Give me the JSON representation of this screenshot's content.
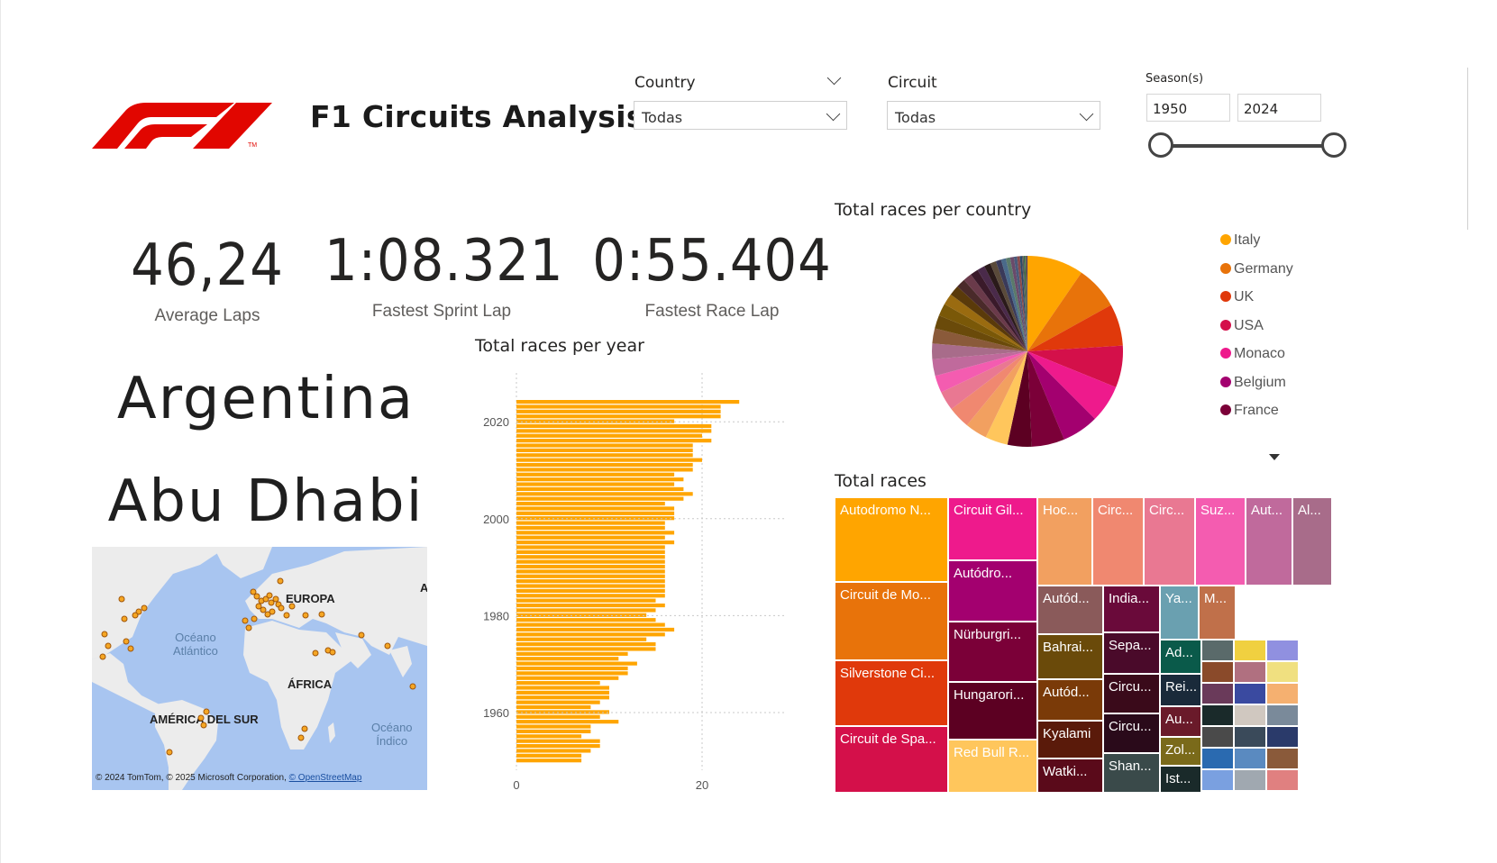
{
  "header": {
    "title": "F1 Circuits Analysis"
  },
  "filters": {
    "country": {
      "label": "Country",
      "value": "Todas"
    },
    "circuit": {
      "label": "Circuit",
      "value": "Todas"
    },
    "season": {
      "label": "Season(s)",
      "from": "1950",
      "to": "2024"
    }
  },
  "kpis": {
    "average_laps": {
      "value": "46,24",
      "label": "Average Laps"
    },
    "fastest_sprint": {
      "value": "1:08.321",
      "label": "Fastest Sprint Lap"
    },
    "fastest_race": {
      "value": "0:55.404",
      "label": "Fastest Race Lap"
    }
  },
  "cards": {
    "country_name": "Argentina",
    "circuit_name": "Abu Dhabi"
  },
  "map": {
    "labels": [
      "EUROPA",
      "ÁFRICA",
      "AMÉRICA DEL SUR",
      "A"
    ],
    "oceans": [
      "Océano\nAtlántico",
      "Océano\nÍndico"
    ],
    "attribution": "© 2024 TomTom, © 2025 Microsoft Corporation,",
    "attribution_link": "© OpenStreetMap"
  },
  "chart_data": [
    {
      "type": "bar",
      "title": "Total races per year",
      "orientation": "horizontal",
      "color": "#FFA500",
      "ytick_labels": [
        "2020",
        "2000",
        "1980",
        "1960"
      ],
      "xtick_labels": [
        "0",
        "20"
      ],
      "xlim": [
        0,
        30
      ],
      "grid": true,
      "years": [
        2024,
        2023,
        2022,
        2021,
        2020,
        2019,
        2018,
        2017,
        2016,
        2015,
        2014,
        2013,
        2012,
        2011,
        2010,
        2009,
        2008,
        2007,
        2006,
        2005,
        2004,
        2003,
        2002,
        2001,
        2000,
        1999,
        1998,
        1997,
        1996,
        1995,
        1994,
        1993,
        1992,
        1991,
        1990,
        1989,
        1988,
        1987,
        1986,
        1985,
        1984,
        1983,
        1982,
        1981,
        1980,
        1979,
        1978,
        1977,
        1976,
        1975,
        1974,
        1973,
        1972,
        1971,
        1970,
        1969,
        1968,
        1967,
        1966,
        1965,
        1964,
        1963,
        1962,
        1961,
        1960,
        1959,
        1958,
        1957,
        1956,
        1955,
        1954,
        1953,
        1952,
        1951,
        1950
      ],
      "values": [
        24,
        22,
        22,
        22,
        17,
        21,
        21,
        20,
        21,
        19,
        19,
        19,
        20,
        19,
        19,
        17,
        18,
        17,
        18,
        19,
        18,
        16,
        17,
        17,
        17,
        16,
        16,
        17,
        16,
        17,
        16,
        16,
        16,
        16,
        16,
        16,
        16,
        16,
        16,
        16,
        16,
        15,
        16,
        15,
        14,
        15,
        16,
        17,
        16,
        14,
        15,
        15,
        12,
        11,
        13,
        12,
        12,
        11,
        9,
        10,
        10,
        10,
        9,
        8,
        10,
        9,
        11,
        8,
        8,
        7,
        9,
        9,
        8,
        7,
        7
      ]
    },
    {
      "type": "pie",
      "title": "Total races per country",
      "legend_position": "right",
      "legend": [
        {
          "name": "Italy",
          "color": "#FFA500"
        },
        {
          "name": "Germany",
          "color": "#E8730A"
        },
        {
          "name": "UK",
          "color": "#E0390B"
        },
        {
          "name": "USA",
          "color": "#D4104A"
        },
        {
          "name": "Monaco",
          "color": "#EE1A8C"
        },
        {
          "name": "Belgium",
          "color": "#A3006F"
        },
        {
          "name": "France",
          "color": "#7B0038"
        }
      ],
      "values": [
        105,
        81,
        78,
        78,
        70,
        68,
        61,
        45,
        42,
        41,
        41,
        36,
        32,
        31,
        29,
        28,
        25,
        23,
        21,
        19,
        17,
        16,
        15,
        14,
        12,
        11,
        10,
        9,
        8,
        7,
        6,
        5,
        4,
        3,
        3,
        2,
        2
      ],
      "colors": [
        "#FFA500",
        "#E8730A",
        "#E0390B",
        "#D4104A",
        "#EE1A8C",
        "#A3006F",
        "#7B0038",
        "#5C0022",
        "#FFC65C",
        "#F2A060",
        "#F08870",
        "#E97892",
        "#F45CB0",
        "#C06A9C",
        "#A86C8A",
        "#8A5A3A",
        "#6A4A0A",
        "#7A5808",
        "#9A6B10",
        "#5A3A0A",
        "#4A2A2A",
        "#6A3A4A",
        "#3A1A2A",
        "#4A2A4A",
        "#2A1A1A",
        "#5A4A3A",
        "#3A3A5A",
        "#4A6A8A",
        "#5A7A6A",
        "#6A4A6A",
        "#4A5A7A",
        "#8A4A4A",
        "#2A4A6A",
        "#5A5A5A",
        "#3A6A4A",
        "#6A6A3A",
        "#4A3A6A"
      ]
    },
    {
      "type": "treemap",
      "title": "Total races",
      "cells": [
        {
          "label": "Autodromo N...",
          "color": "#FFA500"
        },
        {
          "label": "Circuit de Mo...",
          "color": "#E8730A"
        },
        {
          "label": "Silverstone Ci...",
          "color": "#E0390B"
        },
        {
          "label": "Circuit de Spa...",
          "color": "#D4104A"
        },
        {
          "label": "Circuit Gil...",
          "color": "#EE1A8C"
        },
        {
          "label": "Autódro...",
          "color": "#A3006F"
        },
        {
          "label": "Nürburgri...",
          "color": "#7B0038"
        },
        {
          "label": "Hungarori...",
          "color": "#5C0022"
        },
        {
          "label": "Red Bull R...",
          "color": "#FFC65C"
        },
        {
          "label": "Hoc...",
          "color": "#F2A060"
        },
        {
          "label": "Circ...",
          "color": "#F08870"
        },
        {
          "label": "Circ...",
          "color": "#E97892"
        },
        {
          "label": "Suz...",
          "color": "#F45CB0"
        },
        {
          "label": "Aut...",
          "color": "#C06A9C"
        },
        {
          "label": "Al...",
          "color": "#A86C8A"
        },
        {
          "label": "Autód...",
          "color": "#8A5A5A"
        },
        {
          "label": "Bahrai...",
          "color": "#6A4A0A"
        },
        {
          "label": "Autód...",
          "color": "#7A3A08"
        },
        {
          "label": "Kyalami",
          "color": "#5A1A0A"
        },
        {
          "label": "Watki...",
          "color": "#5A0A1A"
        },
        {
          "label": "India...",
          "color": "#6A0A3A"
        },
        {
          "label": "Sepa...",
          "color": "#4A0A2A"
        },
        {
          "label": "Circu...",
          "color": "#3A0A1A"
        },
        {
          "label": "Circu...",
          "color": "#2A0A1A"
        },
        {
          "label": "Shan...",
          "color": "#3A4A4A"
        },
        {
          "label": "Ya...",
          "color": "#6AA0B0"
        },
        {
          "label": "M...",
          "color": "#C0704A"
        },
        {
          "label": "Ad...",
          "color": "#0A5A4A"
        },
        {
          "label": "Rei...",
          "color": "#1A2A3A"
        },
        {
          "label": "Au...",
          "color": "#6A1A2A"
        },
        {
          "label": "Zol...",
          "color": "#7A6A1A"
        },
        {
          "label": "Ist...",
          "color": "#1A2A2A"
        }
      ]
    }
  ]
}
